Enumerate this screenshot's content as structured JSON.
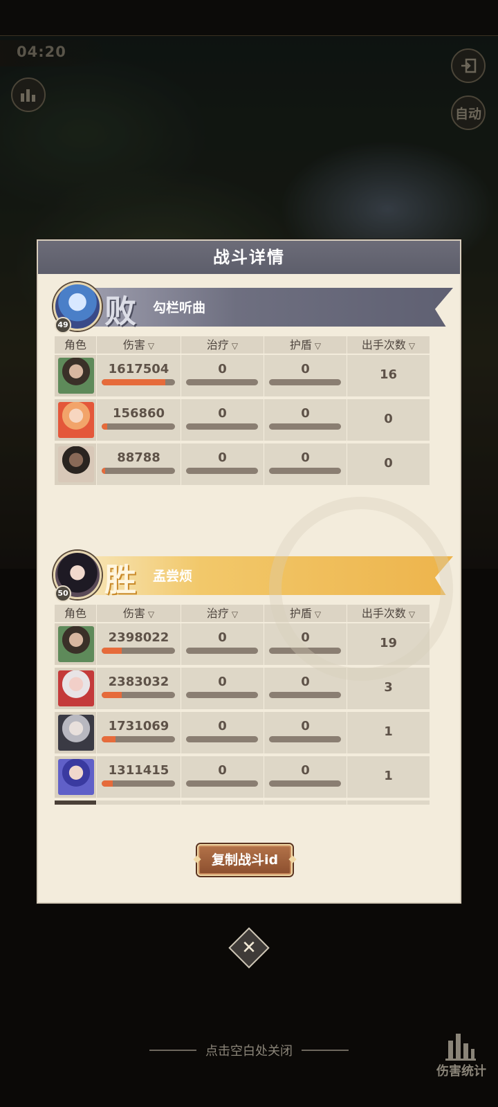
{
  "timer": "04:20",
  "top_buttons": {
    "auto_label": "自动"
  },
  "modal": {
    "title": "战斗详情",
    "copy_button": "复制战斗id"
  },
  "columns": {
    "role": "角色",
    "damage": "伤害",
    "heal": "治疗",
    "shield": "护盾",
    "turns": "出手次数"
  },
  "teams": [
    {
      "result": "败",
      "level": "49",
      "name": "勾栏听曲",
      "rows": [
        {
          "damage": "1617504",
          "damage_ratio": 0.87,
          "heal": "0",
          "shield": "0",
          "turns": "16"
        },
        {
          "damage": "156860",
          "damage_ratio": 0.08,
          "heal": "0",
          "shield": "0",
          "turns": "0"
        },
        {
          "damage": "88788",
          "damage_ratio": 0.05,
          "heal": "0",
          "shield": "0",
          "turns": "0"
        }
      ]
    },
    {
      "result": "胜",
      "level": "50",
      "name": "孟尝烦",
      "rows": [
        {
          "damage": "2398022",
          "damage_ratio": 0.27,
          "heal": "0",
          "shield": "0",
          "turns": "19"
        },
        {
          "damage": "2383032",
          "damage_ratio": 0.27,
          "heal": "0",
          "shield": "0",
          "turns": "3"
        },
        {
          "damage": "1731069",
          "damage_ratio": 0.19,
          "heal": "0",
          "shield": "0",
          "turns": "1"
        },
        {
          "damage": "1311415",
          "damage_ratio": 0.15,
          "heal": "0",
          "shield": "0",
          "turns": "1"
        }
      ]
    }
  ],
  "hint": "点击空白处关闭",
  "damage_stats_label": "伤害统计",
  "colors": {
    "bar_fill": "#e66b3b",
    "bar_track": "#8a7e72",
    "lose_banner": "#6e6f80",
    "win_banner": "#edb44c"
  },
  "icons": [
    "stats-icon",
    "exit-icon",
    "close-icon",
    "sort-icon",
    "bar-chart-icon"
  ]
}
